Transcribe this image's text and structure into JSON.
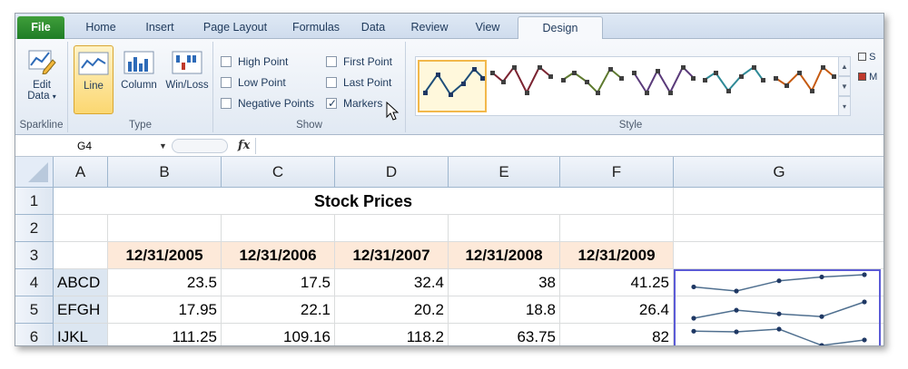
{
  "tabs": [
    "File",
    "Home",
    "Insert",
    "Page Layout",
    "Formulas",
    "Data",
    "Review",
    "View",
    "Design"
  ],
  "active_tab": "Design",
  "ribbon": {
    "sparkline_group": {
      "label": "Sparkline",
      "edit_data": "Edit Data",
      "edit_data_line1": "Edit",
      "edit_data_line2": "Data"
    },
    "type_group": {
      "label": "Type",
      "line": "Line",
      "column": "Column",
      "winloss": "Win/Loss",
      "selected": "Line"
    },
    "show_group": {
      "label": "Show",
      "high_point": {
        "label": "High Point",
        "checked": false
      },
      "low_point": {
        "label": "Low Point",
        "checked": false
      },
      "negative_points": {
        "label": "Negative Points",
        "checked": false
      },
      "first_point": {
        "label": "First Point",
        "checked": false
      },
      "last_point": {
        "label": "Last Point",
        "checked": false
      },
      "markers": {
        "label": "Markers",
        "checked": true
      }
    },
    "style_group": {
      "label": "Style",
      "styles": [
        {
          "line": "#1f4e79",
          "marker": "#1f3864",
          "selected": true
        },
        {
          "line": "#7b2331",
          "marker": "#3f3f3f"
        },
        {
          "line": "#5e7a2f",
          "marker": "#3f3f3f"
        },
        {
          "line": "#5a3a7a",
          "marker": "#3f3f3f"
        },
        {
          "line": "#2f8a97",
          "marker": "#3f3f3f"
        },
        {
          "line": "#c55a11",
          "marker": "#3f3f3f"
        }
      ]
    },
    "right_partial": {
      "item1": "S",
      "item2": "M"
    }
  },
  "formula_bar": {
    "name_box": "G4",
    "fx": "fx",
    "formula": ""
  },
  "columns": [
    "A",
    "B",
    "C",
    "D",
    "E",
    "F",
    "G"
  ],
  "rows": [
    "1",
    "2",
    "3",
    "4",
    "5",
    "6"
  ],
  "sheet": {
    "title": "Stock Prices",
    "dates": [
      "12/31/2005",
      "12/31/2006",
      "12/31/2007",
      "12/31/2008",
      "12/31/2009"
    ],
    "stocks": [
      {
        "ticker": "ABCD",
        "values": [
          "23.5",
          "17.5",
          "32.4",
          "38",
          "41.25"
        ]
      },
      {
        "ticker": "EFGH",
        "values": [
          "17.95",
          "22.1",
          "20.2",
          "18.8",
          "26.4"
        ]
      },
      {
        "ticker": "IJKL",
        "values": [
          "111.25",
          "109.16",
          "118.2",
          "63.75",
          "82"
        ]
      }
    ]
  },
  "colors": {
    "accent": "#3f9e3a",
    "selection": "#5b5bd6",
    "date_header_bg": "#fde9d9",
    "ticker_bg": "#dce6f1",
    "sparkline": "#4f6f8f"
  },
  "icons": {
    "edit_data": "edit-data-icon",
    "line": "line-sparkline-icon",
    "column": "column-sparkline-icon",
    "winloss": "winloss-sparkline-icon",
    "fx": "function-icon",
    "cursor": "mouse-pointer-icon"
  }
}
